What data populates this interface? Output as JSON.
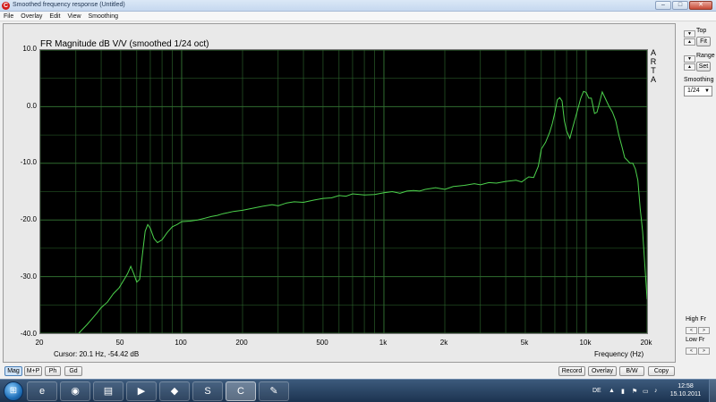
{
  "window": {
    "title": "Smoothed frequency response (Untitled)",
    "controls": {
      "minimize": "–",
      "maximize": "□",
      "close": "✕"
    }
  },
  "menu": [
    "File",
    "Overlay",
    "Edit",
    "View",
    "Smoothing"
  ],
  "side": {
    "top_label": "Top",
    "fit_button": "Fit",
    "range_label": "Range",
    "set_button": "Set",
    "smoothing_label": "Smoothing",
    "smoothing_value": "1/24",
    "high_fr_label": "High Fr",
    "low_fr_label": "Low Fr",
    "arrow_left": "<",
    "arrow_right": ">",
    "arrow_up": "▲",
    "arrow_down": "▼"
  },
  "plot": {
    "arta_label": [
      "A",
      "R",
      "T",
      "A"
    ],
    "cursor_readout": "Cursor: 20.1 Hz, -54.42 dB"
  },
  "chart_data": {
    "type": "line",
    "title": "FR Magnitude dB V/V (smoothed 1/24 oct)",
    "xlabel": "Frequency (Hz)",
    "ylabel": "",
    "x_scale": "log",
    "xlim": [
      20,
      20000
    ],
    "ylim": [
      -40,
      10
    ],
    "y_ticks": [
      10,
      0,
      -10,
      -20,
      -30,
      -40
    ],
    "y_tick_labels": [
      "10.0",
      "0.0",
      "-10.0",
      "-20.0",
      "-30.0",
      "-40.0"
    ],
    "x_ticks": [
      20,
      50,
      100,
      200,
      500,
      1000,
      2000,
      5000,
      10000,
      20000
    ],
    "x_tick_labels": [
      "20",
      "50",
      "100",
      "200",
      "500",
      "1k",
      "2k",
      "5k",
      "10k",
      "20k"
    ],
    "grid": true,
    "background": "#000000",
    "line_color": "#4cd14c",
    "grid_color": "#2f6b2f",
    "series": [
      {
        "x": [
          31,
          34,
          36,
          38,
          40,
          43,
          46,
          49,
          52,
          54,
          56,
          58,
          60,
          62,
          64,
          66,
          68,
          70,
          73,
          76,
          80,
          85,
          90,
          95,
          100,
          110,
          120,
          130,
          140,
          150,
          160,
          170,
          180,
          200,
          220,
          250,
          280,
          300,
          330,
          360,
          400,
          450,
          500,
          550,
          600,
          650,
          700,
          800,
          900,
          1000,
          1100,
          1200,
          1300,
          1400,
          1500,
          1600,
          1800,
          2000,
          2200,
          2500,
          2800,
          3000,
          3300,
          3600,
          4000,
          4500,
          4800,
          5000,
          5200,
          5500,
          5800,
          6000,
          6300,
          6600,
          6800,
          7000,
          7200,
          7400,
          7600,
          7800,
          8000,
          8300,
          8600,
          9000,
          9400,
          9700,
          10000,
          10300,
          10600,
          11000,
          11300,
          11600,
          12000,
          12300,
          12600,
          13000,
          13500,
          14000,
          14500,
          15000,
          15500,
          16000,
          16500,
          17000,
          17500,
          18000,
          18500,
          19000,
          19500,
          20000
        ],
        "y": [
          -40,
          -38.5,
          -37.5,
          -36.5,
          -35.5,
          -34.5,
          -33,
          -32,
          -30.5,
          -29.5,
          -28.2,
          -29.5,
          -31,
          -30.5,
          -26,
          -22,
          -20.8,
          -21.5,
          -23.3,
          -24,
          -23.5,
          -22.2,
          -21.2,
          -20.8,
          -20.3,
          -20.2,
          -20,
          -19.7,
          -19.4,
          -19.2,
          -18.9,
          -18.7,
          -18.5,
          -18.3,
          -18.0,
          -17.6,
          -17.3,
          -17.5,
          -17.0,
          -16.8,
          -16.9,
          -16.5,
          -16.2,
          -16.1,
          -15.7,
          -15.8,
          -15.4,
          -15.6,
          -15.5,
          -15.2,
          -15.0,
          -15.3,
          -14.9,
          -14.8,
          -14.9,
          -14.6,
          -14.3,
          -14.6,
          -14.1,
          -13.9,
          -13.6,
          -13.8,
          -13.4,
          -13.5,
          -13.2,
          -13.0,
          -13.3,
          -12.8,
          -12.4,
          -12.5,
          -10.5,
          -7.5,
          -6.3,
          -4.5,
          -3.0,
          -1.0,
          1.2,
          1.6,
          1.0,
          -2.5,
          -4.3,
          -5.6,
          -3.5,
          -1.0,
          1.5,
          2.7,
          2.5,
          1.5,
          1.5,
          -1.2,
          -1.0,
          0.5,
          2.6,
          1.8,
          1.0,
          0.0,
          -1.0,
          -2.5,
          -5.0,
          -7.0,
          -9.0,
          -9.5,
          -10.0,
          -10.0,
          -11.0,
          -13.0,
          -18.0,
          -22.0,
          -28.0,
          -34.0
        ]
      }
    ]
  },
  "toolbar": {
    "left": [
      "Mag",
      "M+P",
      "Ph",
      "Gd"
    ],
    "right": [
      "Record",
      "Overlay",
      "B/W",
      "Copy"
    ]
  },
  "taskbar": {
    "start_glyph": "⊞",
    "apps": [
      {
        "name": "internet-explorer",
        "glyph": "e"
      },
      {
        "name": "firefox",
        "glyph": "◉"
      },
      {
        "name": "explorer",
        "glyph": "▤"
      },
      {
        "name": "media-player",
        "glyph": "▶"
      },
      {
        "name": "player-alt",
        "glyph": "◆"
      },
      {
        "name": "skype",
        "glyph": "S"
      },
      {
        "name": "arta",
        "glyph": "C"
      },
      {
        "name": "paint",
        "glyph": "✎"
      }
    ],
    "language": "DE",
    "time": "12:58",
    "date": "15.10.2011"
  }
}
